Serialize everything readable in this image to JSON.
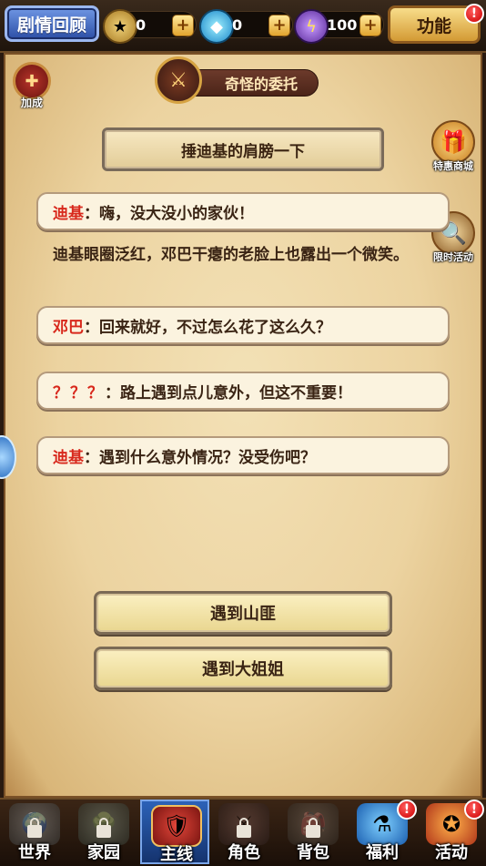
{
  "topbar": {
    "story_review": "剧情回顾",
    "resources": [
      {
        "icon": "gold-coin-icon",
        "value": "0",
        "color": "#d8b04a"
      },
      {
        "icon": "diamond-icon",
        "value": "0",
        "color": "#3fc6f2"
      },
      {
        "icon": "energy-icon",
        "value": "100",
        "color": "#8a52c9"
      }
    ],
    "function_label": "功能",
    "function_badge": "!"
  },
  "quest": {
    "title": "奇怪的委托",
    "bonus_label": "加成",
    "chapter": "捶迪基的肩膀一下"
  },
  "side": {
    "shop_label": "特惠商城",
    "event_label": "限时活动"
  },
  "dialogue": [
    {
      "speaker": "迪基",
      "sep": "：",
      "text": "嗨，没大没小的家伙！"
    },
    {
      "speaker": "邓巴",
      "sep": "：",
      "text": "回来就好，不过怎么花了这么久？"
    },
    {
      "speaker": "？？？",
      "sep": "：",
      "text": "路上遇到点儿意外，但这不重要！"
    },
    {
      "speaker": "迪基",
      "sep": "：",
      "text": "遇到什么意外情况？没受伤吧？"
    }
  ],
  "narration": "迪基眼圈泛红，邓巴干瘪的老脸上也露出一个微笑。",
  "choices": [
    "遇到山匪",
    "遇到大姐姐"
  ],
  "nav": [
    {
      "label": "世界",
      "locked": true
    },
    {
      "label": "家园",
      "locked": true
    },
    {
      "label": "主线",
      "active": true
    },
    {
      "label": "角色",
      "locked": true
    },
    {
      "label": "背包",
      "locked": true
    },
    {
      "label": "福利",
      "badge": "!"
    },
    {
      "label": "活动",
      "badge": "!"
    }
  ]
}
